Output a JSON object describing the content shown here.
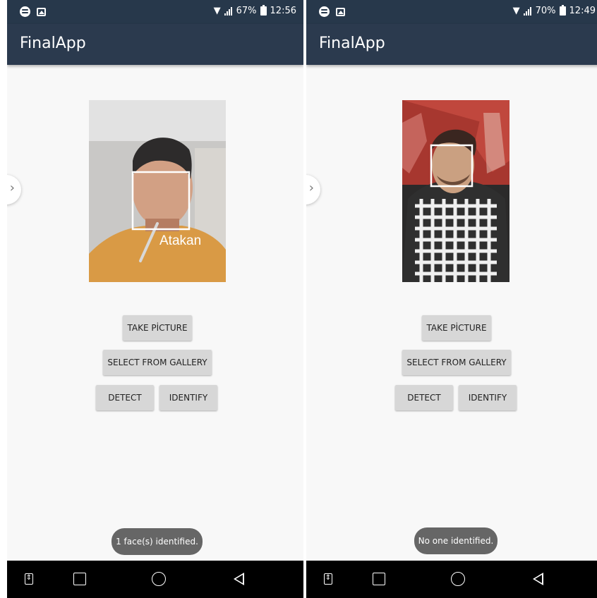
{
  "screens": [
    {
      "status": {
        "battery": "67%",
        "time": "12:56"
      },
      "app_title": "FinalApp",
      "face_name": "Atakan",
      "buttons": {
        "take_picture": "TAKE PİCTURE",
        "select_from_gallery": "SELECT FROM GALLERY",
        "detect": "DETECT",
        "identify": "IDENTIFY"
      },
      "toast": "1 face(s) identified."
    },
    {
      "status": {
        "battery": "70%",
        "time": "12:49"
      },
      "app_title": "FinalApp",
      "buttons": {
        "take_picture": "TAKE PİCTURE",
        "select_from_gallery": "SELECT FROM GALLERY",
        "detect": "DETECT",
        "identify": "IDENTIFY"
      },
      "toast": "No one identified."
    }
  ],
  "icons": {
    "status": [
      "spotify-icon",
      "gallery-icon",
      "wifi-icon",
      "signal-icon",
      "battery-icon"
    ],
    "nav": [
      "toggle-icon",
      "recent-apps-icon",
      "home-icon",
      "back-icon"
    ],
    "drawer": "chevron-right-icon"
  },
  "colors": {
    "status_bar": "#27384b",
    "app_bar": "#2b3a4e",
    "background": "#f8f8f8",
    "button": "#d7d7d7",
    "toast": "#666666"
  }
}
